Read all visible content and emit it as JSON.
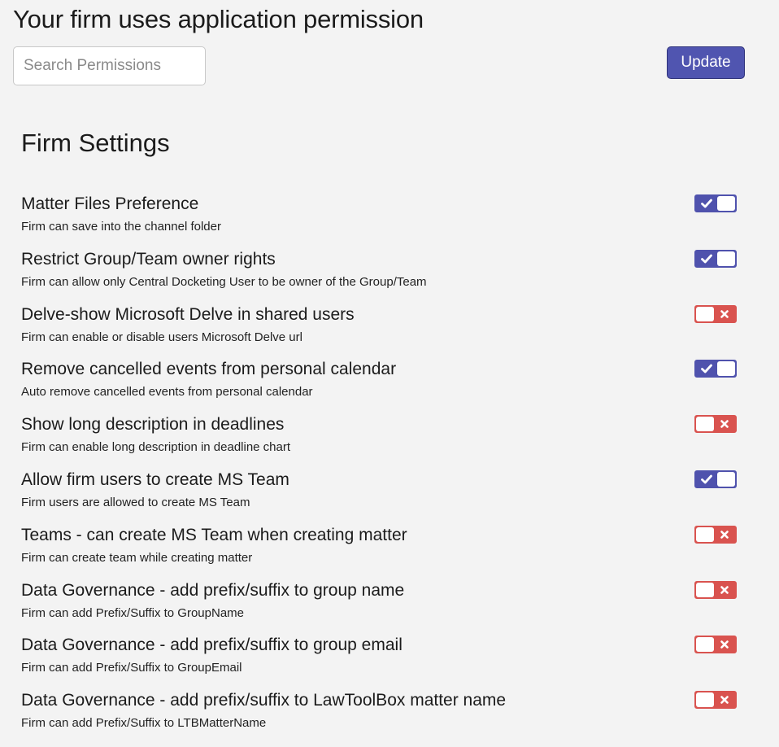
{
  "header": {
    "title": "Your firm uses application permission"
  },
  "search": {
    "placeholder": "Search Permissions",
    "value": ""
  },
  "toolbar": {
    "update_label": "Update"
  },
  "section": {
    "title": "Firm Settings"
  },
  "colors": {
    "toggle_on": "#4f52ad",
    "toggle_off": "#d9534f",
    "button_bg": "#5055b0",
    "page_bg": "#f3f3f3"
  },
  "settings": [
    {
      "title": "Matter Files Preference",
      "description": "Firm can save into the channel folder",
      "enabled": true,
      "icon": "check-icon"
    },
    {
      "title": "Restrict Group/Team owner rights",
      "description": "Firm can allow only Central Docketing User to be owner of the Group/Team",
      "enabled": true,
      "icon": "check-icon"
    },
    {
      "title": "Delve-show Microsoft Delve in shared users",
      "description": "Firm can enable or disable users Microsoft Delve url",
      "enabled": false,
      "icon": "x-icon"
    },
    {
      "title": "Remove cancelled events from personal calendar",
      "description": "Auto remove cancelled events from personal calendar",
      "enabled": true,
      "icon": "check-icon"
    },
    {
      "title": "Show long description in deadlines",
      "description": "Firm can enable long description in deadline chart",
      "enabled": false,
      "icon": "x-icon"
    },
    {
      "title": "Allow firm users to create MS Team",
      "description": "Firm users are allowed to create MS Team",
      "enabled": true,
      "icon": "check-icon"
    },
    {
      "title": "Teams - can create MS Team when creating matter",
      "description": "Firm can create team while creating matter",
      "enabled": false,
      "icon": "x-icon"
    },
    {
      "title": "Data Governance - add prefix/suffix to group name",
      "description": "Firm can add Prefix/Suffix to GroupName",
      "enabled": false,
      "icon": "x-icon"
    },
    {
      "title": "Data Governance - add prefix/suffix to group email",
      "description": "Firm can add Prefix/Suffix to GroupEmail",
      "enabled": false,
      "icon": "x-icon"
    },
    {
      "title": "Data Governance - add prefix/suffix to LawToolBox matter name",
      "description": "Firm can add Prefix/Suffix to LTBMatterName",
      "enabled": false,
      "icon": "x-icon"
    }
  ]
}
